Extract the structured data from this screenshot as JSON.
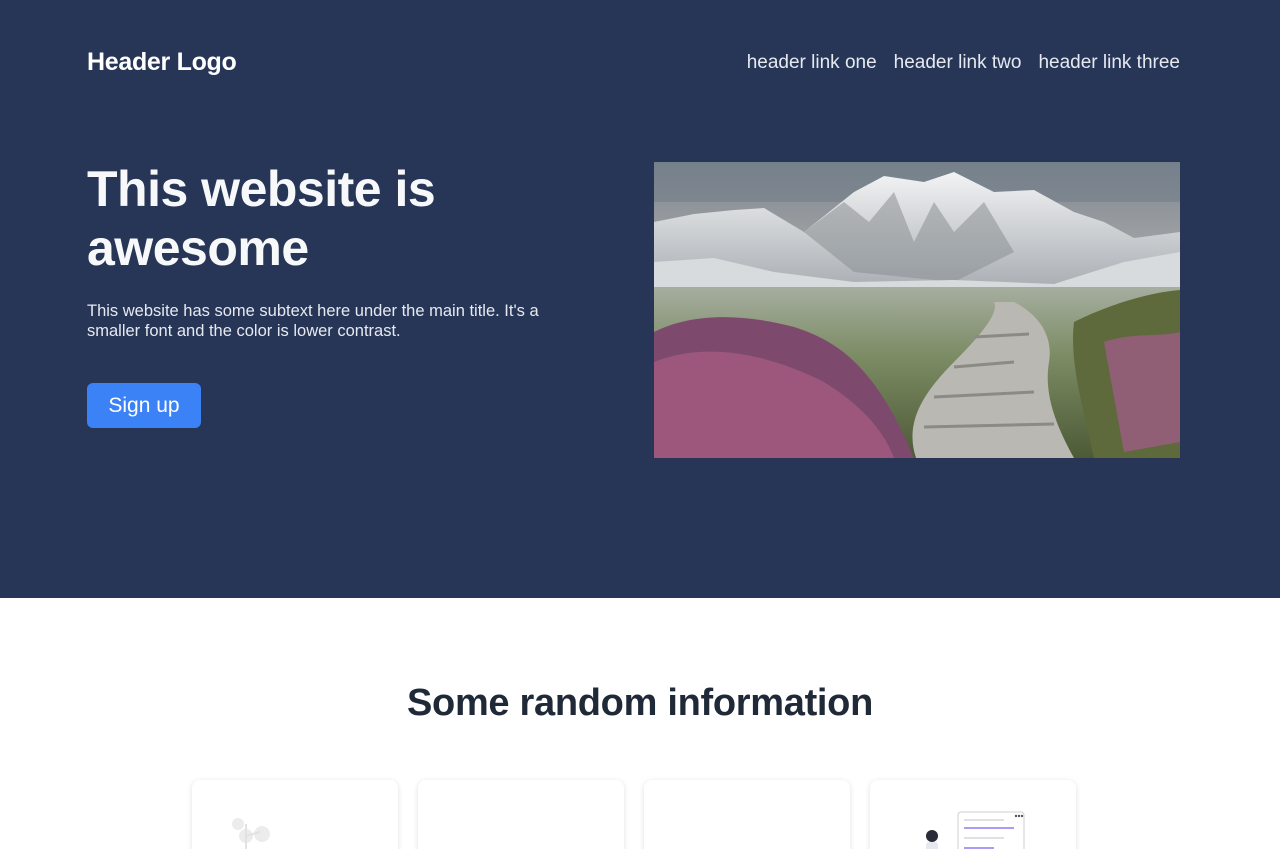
{
  "header": {
    "logo": "Header Logo",
    "links": [
      {
        "label": "header link one"
      },
      {
        "label": "header link two"
      },
      {
        "label": "header link three"
      }
    ]
  },
  "hero": {
    "title": "This website is awesome",
    "subtitle": "This website has some subtext here under the main title. It's a smaller font and the color is lower contrast.",
    "cta_label": "Sign up",
    "image_description": "mountain-path-landscape"
  },
  "info": {
    "title": "Some random information",
    "cards": [
      {
        "illustration": "plant-illustration-icon"
      },
      {
        "illustration": "none"
      },
      {
        "illustration": "none"
      },
      {
        "illustration": "person-dashboard-illustration-icon"
      }
    ]
  },
  "colors": {
    "hero_bg": "#273657",
    "button": "#3b82f6",
    "text_dark": "#1f2937"
  }
}
